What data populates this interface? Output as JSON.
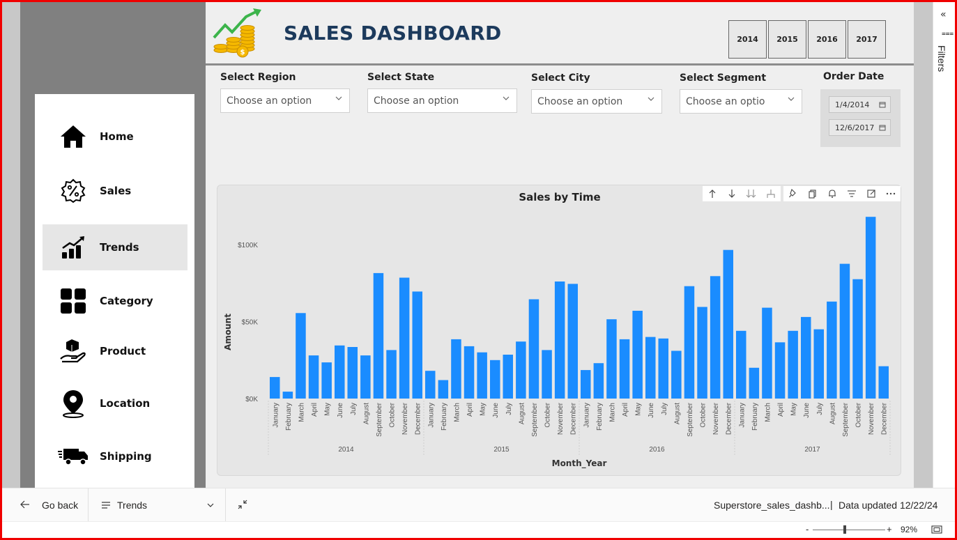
{
  "header": {
    "title": "SALES DASHBOARD",
    "year_buttons": [
      "2014",
      "2015",
      "2016",
      "2017"
    ]
  },
  "nav": {
    "items": [
      {
        "label": "Home",
        "icon": "home-icon"
      },
      {
        "label": "Sales",
        "icon": "percent-badge-icon"
      },
      {
        "label": "Trends",
        "icon": "trend-chart-icon",
        "active": true
      },
      {
        "label": "Category",
        "icon": "grid-icon"
      },
      {
        "label": "Product",
        "icon": "hand-box-icon"
      },
      {
        "label": "Location",
        "icon": "map-pin-icon"
      },
      {
        "label": "Shipping",
        "icon": "truck-icon"
      }
    ]
  },
  "slicers": {
    "region": {
      "title": "Select Region",
      "value": "Choose an option"
    },
    "state": {
      "title": "Select State",
      "value": "Choose an option"
    },
    "city": {
      "title": "Select City",
      "value": "Choose an option"
    },
    "segment": {
      "title": "Select Segment",
      "value": "Choose an optio"
    },
    "order_date": {
      "title": "Order Date",
      "start": "1/4/2014",
      "end": "12/6/2017"
    }
  },
  "filters_pane": {
    "label": "Filters"
  },
  "bottom_bar": {
    "go_back": "Go back",
    "page_selector": "Trends",
    "report_name": "Superstore_sales_dashb...",
    "separator": "|",
    "data_updated": "Data updated 12/22/24",
    "zoom_minus": "-",
    "zoom_plus": "+",
    "zoom": "92%"
  },
  "colors": {
    "bar": "#1a8cff",
    "title": "#1c3a5c"
  },
  "chart_data": {
    "type": "bar",
    "title": "Sales by Time",
    "xlabel": "Month_Year",
    "ylabel": "Amount",
    "ylim": [
      0,
      120000
    ],
    "yticks": [
      "$0K",
      "$50K",
      "$100K"
    ],
    "ytick_values": [
      0,
      50000,
      100000
    ],
    "months": [
      "January",
      "February",
      "March",
      "April",
      "May",
      "June",
      "July",
      "August",
      "September",
      "October",
      "November",
      "December"
    ],
    "years": [
      "2014",
      "2015",
      "2016",
      "2017"
    ],
    "series": [
      {
        "values": [
          14000,
          4500,
          55500,
          28000,
          23500,
          34500,
          33500,
          28000,
          81500,
          31500,
          78500,
          69500,
          18000,
          12000,
          38500,
          34000,
          30000,
          25000,
          28500,
          37000,
          64500,
          31500,
          76000,
          74500,
          18500,
          23000,
          51500,
          38500,
          57000,
          40000,
          39000,
          31000,
          73000,
          59500,
          79500,
          96500,
          44000,
          20000,
          59000,
          36500,
          44000,
          53000,
          45000,
          63000,
          87500,
          77500,
          118000,
          21000
        ]
      }
    ]
  }
}
